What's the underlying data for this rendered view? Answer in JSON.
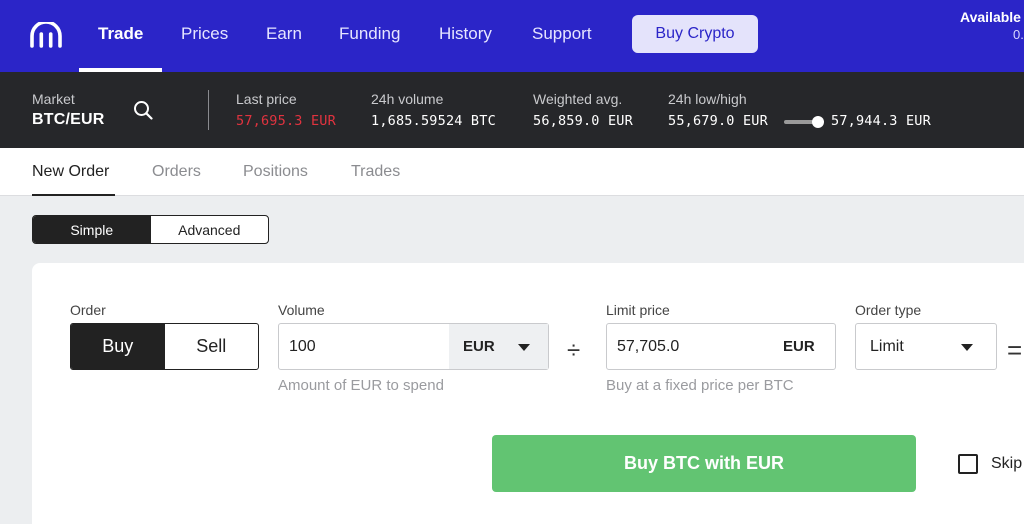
{
  "colors": {
    "brand": "#2b25c8",
    "dark": "#26272a",
    "buy_green": "#62c472",
    "price_red": "#e0333f"
  },
  "nav": {
    "logo_icon": "kraken-logo-icon",
    "items": [
      "Trade",
      "Prices",
      "Earn",
      "Funding",
      "History",
      "Support"
    ],
    "active": "Trade",
    "buy_crypto": "Buy Crypto",
    "available_label": "Available",
    "available_value": "0."
  },
  "market": {
    "market_label": "Market",
    "pair": "BTC/EUR",
    "search_icon": "search-icon",
    "last_price_label": "Last price",
    "last_price": "57,695.3 EUR",
    "volume_label": "24h volume",
    "volume": "1,685.59524 BTC",
    "weighted_label": "Weighted avg.",
    "weighted": "56,859.0 EUR",
    "lowhigh_label": "24h low/high",
    "low": "55,679.0 EUR",
    "high": "57,944.3 EUR"
  },
  "tabs": [
    "New Order",
    "Orders",
    "Positions",
    "Trades"
  ],
  "active_tab": "New Order",
  "mode": {
    "options": [
      "Simple",
      "Advanced"
    ],
    "selected": "Simple"
  },
  "order": {
    "order_label": "Order",
    "sides": [
      "Buy",
      "Sell"
    ],
    "selected_side": "Buy",
    "volume_label": "Volume",
    "volume_value": "100",
    "volume_currency": "EUR",
    "volume_hint": "Amount of EUR to spend",
    "limit_label": "Limit price",
    "limit_value": "57,705.0",
    "limit_currency": "EUR",
    "limit_hint": "Buy at a fixed price per BTC",
    "type_label": "Order type",
    "type_value": "Limit",
    "divide_icon": "÷",
    "equals_icon": "=",
    "submit": "Buy BTC with EUR",
    "skip_label": "Skip"
  }
}
